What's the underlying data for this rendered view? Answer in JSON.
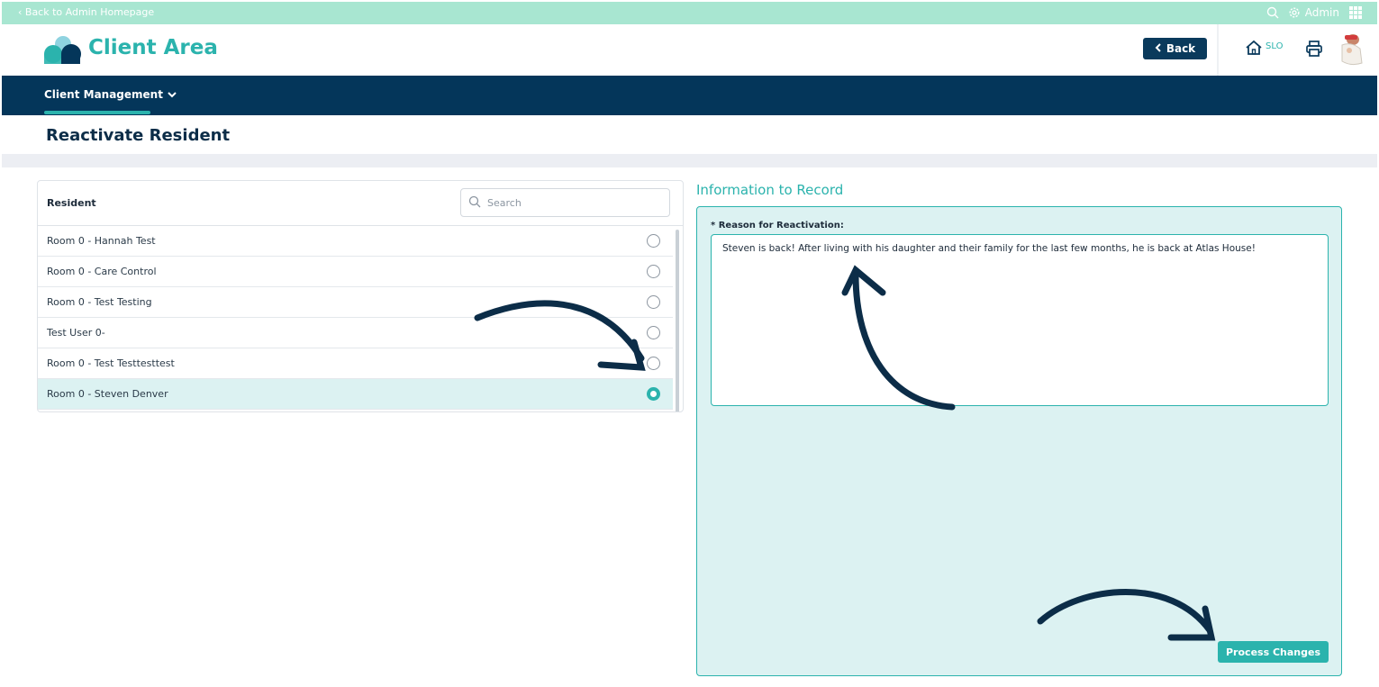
{
  "topbar": {
    "back_link": "‹ Back to Admin Homepage",
    "admin_label": "Admin",
    "icons": [
      "search-icon",
      "gear-icon",
      "apps-grid-icon"
    ]
  },
  "header": {
    "brand": "Client Area",
    "back_button": "Back",
    "home_label": "SLO",
    "icons": [
      "logo-icon",
      "home-icon",
      "print-icon",
      "avatar"
    ]
  },
  "nav": {
    "items": [
      {
        "label": "Client Management"
      }
    ]
  },
  "page": {
    "title": "Reactivate Resident"
  },
  "resident_list": {
    "header_label": "Resident",
    "search_placeholder": "Search",
    "rows": [
      {
        "name": "Room 0 - Hannah Test",
        "selected": false
      },
      {
        "name": "Room 0 - Care Control",
        "selected": false
      },
      {
        "name": "Room 0 - Test Testing",
        "selected": false
      },
      {
        "name": "Test User 0-",
        "selected": false
      },
      {
        "name": "Room 0 - Test Testtesttest",
        "selected": false
      },
      {
        "name": "Room 0 - Steven Denver",
        "selected": true
      }
    ]
  },
  "info": {
    "title": "Information to Record",
    "field_label": "* Reason for Reactivation:",
    "reason_value": "Steven is back! After living with his daughter and their family for the last few months, he is back at Atlas House!",
    "process_button": "Process Changes"
  },
  "colors": {
    "accent": "#2bb3ad",
    "navy": "#04365a",
    "topbar": "#a8e6d1",
    "panel_bg": "#dcf2f2"
  }
}
